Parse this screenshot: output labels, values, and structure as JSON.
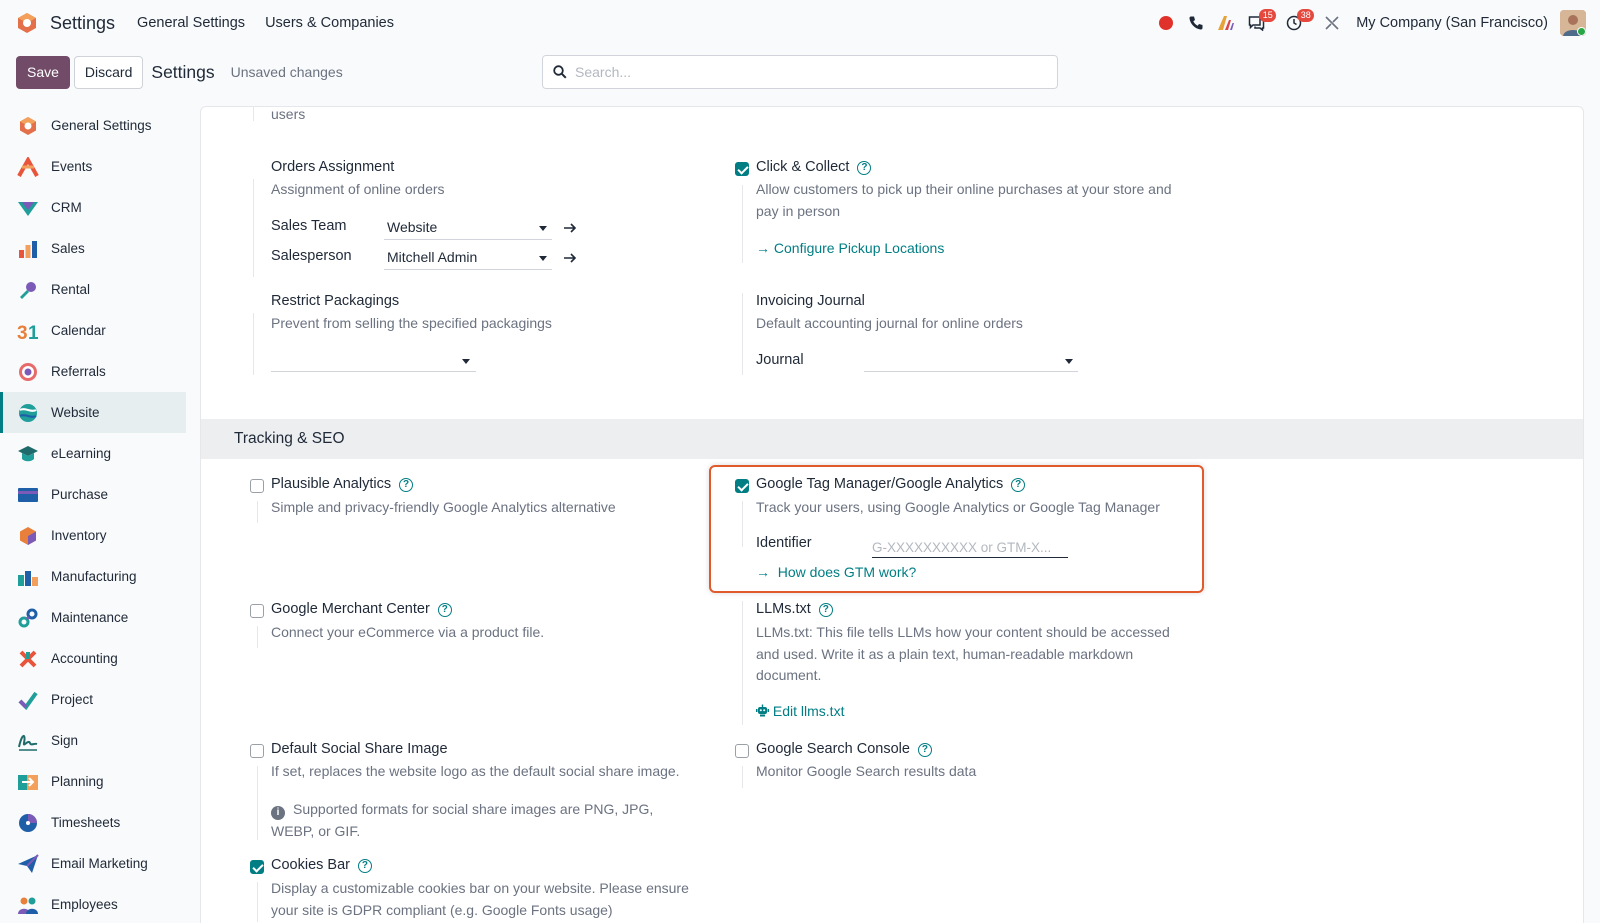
{
  "topbar": {
    "app_title": "Settings",
    "nav": [
      "General Settings",
      "Users & Companies"
    ],
    "badges": {
      "messages": "15",
      "activities": "38"
    },
    "company": "My Company (San Francisco)"
  },
  "controlbar": {
    "save_label": "Save",
    "discard_label": "Discard",
    "title": "Settings",
    "status": "Unsaved changes"
  },
  "search": {
    "placeholder": "Search..."
  },
  "sidebar": {
    "active": "Website",
    "items": [
      {
        "label": "General Settings",
        "icon": "general-settings-icon"
      },
      {
        "label": "Events",
        "icon": "events-icon"
      },
      {
        "label": "CRM",
        "icon": "crm-icon"
      },
      {
        "label": "Sales",
        "icon": "sales-icon"
      },
      {
        "label": "Rental",
        "icon": "rental-icon"
      },
      {
        "label": "Calendar",
        "icon": "calendar-icon"
      },
      {
        "label": "Referrals",
        "icon": "referrals-icon"
      },
      {
        "label": "Website",
        "icon": "website-icon"
      },
      {
        "label": "eLearning",
        "icon": "elearning-icon"
      },
      {
        "label": "Purchase",
        "icon": "purchase-icon"
      },
      {
        "label": "Inventory",
        "icon": "inventory-icon"
      },
      {
        "label": "Manufacturing",
        "icon": "manufacturing-icon"
      },
      {
        "label": "Maintenance",
        "icon": "maintenance-icon"
      },
      {
        "label": "Accounting",
        "icon": "accounting-icon"
      },
      {
        "label": "Project",
        "icon": "project-icon"
      },
      {
        "label": "Sign",
        "icon": "sign-icon"
      },
      {
        "label": "Planning",
        "icon": "planning-icon"
      },
      {
        "label": "Timesheets",
        "icon": "timesheets-icon"
      },
      {
        "label": "Email Marketing",
        "icon": "email-marketing-icon"
      },
      {
        "label": "Employees",
        "icon": "employees-icon"
      }
    ]
  },
  "content": {
    "top_fragment": "users",
    "orders_assignment": {
      "title": "Orders Assignment",
      "desc": "Assignment of online orders",
      "sales_team_label": "Sales Team",
      "sales_team_value": "Website",
      "salesperson_label": "Salesperson",
      "salesperson_value": "Mitchell Admin"
    },
    "click_collect": {
      "title": "Click & Collect",
      "checked": true,
      "desc": "Allow customers to pick up their online purchases at your store and pay in person",
      "link": "Configure Pickup Locations"
    },
    "restrict_packagings": {
      "title": "Restrict Packagings",
      "desc": "Prevent from selling the specified packagings"
    },
    "invoicing_journal": {
      "title": "Invoicing Journal",
      "desc": "Default accounting journal for online orders",
      "journal_label": "Journal"
    },
    "section_tracking": "Tracking & SEO",
    "plausible": {
      "title": "Plausible Analytics",
      "checked": false,
      "desc": "Simple and privacy-friendly Google Analytics alternative"
    },
    "gtm": {
      "title": "Google Tag Manager/Google Analytics",
      "checked": true,
      "desc": "Track your users, using Google Analytics or Google Tag Manager",
      "identifier_label": "Identifier",
      "identifier_placeholder": "G-XXXXXXXXXX or GTM-X...",
      "link": "How does GTM work?"
    },
    "merchant": {
      "title": "Google Merchant Center",
      "checked": false,
      "desc": "Connect your eCommerce via a product file."
    },
    "llms": {
      "title": "LLMs.txt",
      "desc": "LLMs.txt: This file tells LLMs how your content should be accessed and used. Write it as a plain text, human-readable markdown document.",
      "link": "Edit llms.txt"
    },
    "social_share": {
      "title": "Default Social Share Image",
      "checked": false,
      "desc": "If set, replaces the website logo as the default social share image.",
      "note": "Supported formats for social share images are PNG, JPG, WEBP, or GIF."
    },
    "search_console": {
      "title": "Google Search Console",
      "checked": false,
      "desc": "Monitor Google Search results data"
    },
    "cookies_bar": {
      "title": "Cookies Bar",
      "checked": true,
      "desc": "Display a customizable cookies bar on your website. Please ensure your site is GDPR compliant (e.g. Google Fonts usage)"
    }
  },
  "colors": {
    "brand": "#714b67",
    "accent": "#017e84",
    "highlight": "#e05a2b",
    "badge": "#e5483d"
  }
}
